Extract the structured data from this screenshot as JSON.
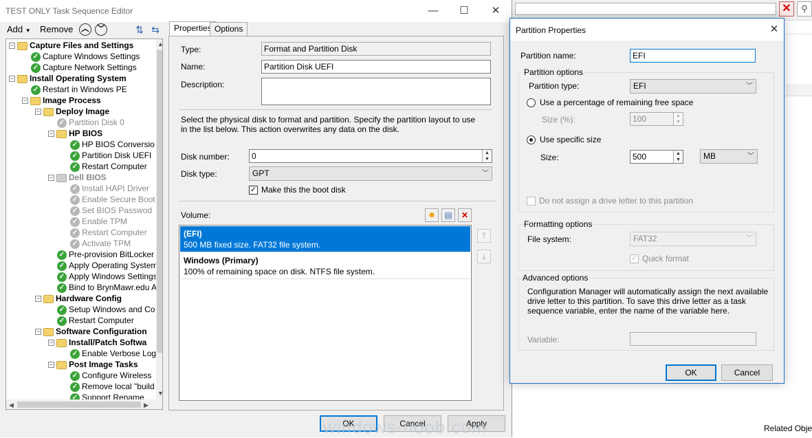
{
  "background_app": {
    "related_objects_label": "Related Objec"
  },
  "editor": {
    "title": "TEST ONLY Task Sequence Editor",
    "toolbar": {
      "add_label": "Add",
      "remove_label": "Remove"
    },
    "tabs": [
      "Properties",
      "Options"
    ],
    "tree": [
      {
        "label": "Capture Files and Settings",
        "level": 0,
        "icon": "folder",
        "bold": true,
        "expander": "minus"
      },
      {
        "label": "Capture Windows Settings",
        "level": 1,
        "icon": "check"
      },
      {
        "label": "Capture Network Settings",
        "level": 1,
        "icon": "check"
      },
      {
        "label": "Install Operating System",
        "level": 0,
        "icon": "folder",
        "bold": true,
        "expander": "minus"
      },
      {
        "label": "Restart in Windows PE",
        "level": 1,
        "icon": "check"
      },
      {
        "label": "Image Process",
        "level": 1,
        "icon": "folder",
        "bold": true,
        "expander": "minus"
      },
      {
        "label": "Deploy Image",
        "level": 2,
        "icon": "folder",
        "bold": true,
        "expander": "minus"
      },
      {
        "label": "Partition Disk 0",
        "level": 3,
        "icon": "check-gray",
        "gray": true
      },
      {
        "label": "HP BIOS",
        "level": 3,
        "icon": "folder",
        "bold": true,
        "expander": "minus"
      },
      {
        "label": "HP BIOS Conversio",
        "level": 4,
        "icon": "check"
      },
      {
        "label": "Partition Disk UEFI",
        "level": 4,
        "icon": "check"
      },
      {
        "label": "Restart Computer",
        "level": 4,
        "icon": "check"
      },
      {
        "label": "Dell BIOS",
        "level": 3,
        "icon": "folder-gray",
        "bold": true,
        "gray": true,
        "expander": "minus"
      },
      {
        "label": "Install HAPI Driver",
        "level": 4,
        "icon": "check-gray",
        "gray": true
      },
      {
        "label": "Enable Secure Boot",
        "level": 4,
        "icon": "check-gray",
        "gray": true
      },
      {
        "label": "Set BIOS Passwod",
        "level": 4,
        "icon": "check-gray",
        "gray": true
      },
      {
        "label": "Enable TPM",
        "level": 4,
        "icon": "check-gray",
        "gray": true
      },
      {
        "label": "Restart Computer",
        "level": 4,
        "icon": "check-gray",
        "gray": true
      },
      {
        "label": "Activate TPM",
        "level": 4,
        "icon": "check-gray",
        "gray": true
      },
      {
        "label": "Pre-provision BitLocker",
        "level": 3,
        "icon": "check"
      },
      {
        "label": "Apply Operating System",
        "level": 3,
        "icon": "check"
      },
      {
        "label": "Apply Windows Settings",
        "level": 3,
        "icon": "check"
      },
      {
        "label": "Bind to BrynMawr.edu A",
        "level": 3,
        "icon": "check"
      },
      {
        "label": "Hardware Config",
        "level": 2,
        "icon": "folder",
        "bold": true,
        "expander": "minus"
      },
      {
        "label": "Setup Windows and Co",
        "level": 3,
        "icon": "check"
      },
      {
        "label": "Restart Computer",
        "level": 3,
        "icon": "check"
      },
      {
        "label": "Software Configuration",
        "level": 2,
        "icon": "folder",
        "bold": true,
        "expander": "minus"
      },
      {
        "label": "Install/Patch Softwa",
        "level": 3,
        "icon": "folder",
        "bold": true,
        "expander": "minus"
      },
      {
        "label": "Enable Verbose Log",
        "level": 4,
        "icon": "check"
      },
      {
        "label": "Post Image Tasks",
        "level": 3,
        "icon": "folder",
        "bold": true,
        "expander": "minus"
      },
      {
        "label": "Configure Wireless",
        "level": 4,
        "icon": "check"
      },
      {
        "label": "Remove local \"build",
        "level": 4,
        "icon": "check"
      },
      {
        "label": "Support Rename",
        "level": 4,
        "icon": "check"
      }
    ],
    "properties": {
      "type_label": "Type:",
      "type_value": "Format and Partition Disk",
      "name_label": "Name:",
      "name_value": "Partition Disk UEFI",
      "description_label": "Description:",
      "description_value": "",
      "instructions": "Select the physical disk to format and partition. Specify the partition layout to use in the list below. This action overwrites any data on the disk.",
      "disk_number_label": "Disk number:",
      "disk_number_value": "0",
      "disk_type_label": "Disk type:",
      "disk_type_value": "GPT",
      "boot_disk_label": "Make this the boot disk",
      "boot_disk_checked": true,
      "volume_label": "Volume:",
      "volumes": [
        {
          "title": "(EFI)",
          "detail": "500 MB fixed size. FAT32 file system.",
          "selected": true
        },
        {
          "title": "Windows (Primary)",
          "detail": "100% of remaining space on disk. NTFS file system.",
          "selected": false
        }
      ]
    },
    "buttons": {
      "ok": "OK",
      "cancel": "Cancel",
      "apply": "Apply"
    }
  },
  "dialog": {
    "title": "Partition Properties",
    "partition_name_label": "Partition name:",
    "partition_name_value": "EFI",
    "partition_options_label": "Partition options",
    "partition_type_label": "Partition type:",
    "partition_type_value": "EFI",
    "use_percentage_label": "Use a percentage of remaining free space",
    "size_percent_label": "Size (%):",
    "size_percent_value": "100",
    "use_specific_label": "Use specific size",
    "size_label": "Size:",
    "size_value": "500",
    "size_unit": "MB",
    "no_drive_letter_label": "Do not assign a drive letter to this partition",
    "formatting_options_label": "Formatting options",
    "file_system_label": "File system:",
    "file_system_value": "FAT32",
    "quick_format_label": "Quick format",
    "advanced_options_label": "Advanced options",
    "advanced_text": "Configuration Manager will automatically assign the next available drive letter to this partition. To save this drive letter as a task sequence variable, enter the name of the variable here.",
    "variable_label": "Variable:",
    "variable_value": "",
    "ok": "OK",
    "cancel": "Cancel"
  },
  "watermark": "windows-noob.com"
}
